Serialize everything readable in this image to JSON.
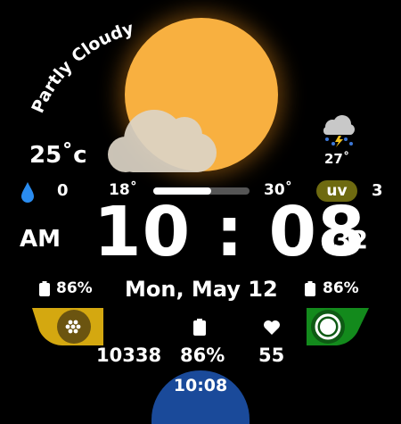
{
  "weather": {
    "condition": "Partly Cloudy",
    "temperature": "25˚c",
    "humidity": "0",
    "min_temp": "18˚",
    "max_temp": "30˚",
    "temp_range_fill_fraction": 0.6,
    "uv_label": "uv",
    "uv_index": "3",
    "forecast_temp": "27˚"
  },
  "time": {
    "ampm": "AM",
    "main": "10 : 08",
    "seconds": "32",
    "date": "Mon, May 12",
    "bottom": "10:08"
  },
  "status": {
    "battery_left": "86%",
    "battery_right": "86%",
    "steps": "10338",
    "battery_center": "86%",
    "heart_rate": "55"
  },
  "colors": {
    "sun": "#f8b040",
    "uv_badge": "#6e6a10",
    "left_shortcut": "#d4a810",
    "right_shortcut": "#138a1c",
    "bottom_bar": "#1a4a9a"
  },
  "icons": {
    "humidity": "water-drop-icon",
    "forecast": "storm-cloud-icon",
    "battery": "battery-icon",
    "heart": "heart-icon",
    "apps": "apps-icon",
    "record": "record-icon"
  }
}
